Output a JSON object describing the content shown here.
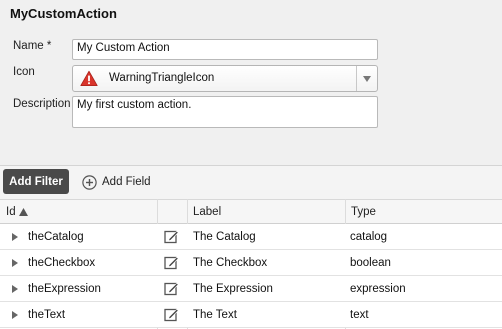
{
  "panel": {
    "title": "MyCustomAction"
  },
  "form": {
    "name_label": "Name *",
    "name_value": "My Custom Action",
    "icon_label": "Icon",
    "icon_value": "WarningTriangleIcon",
    "description_label": "Description",
    "description_value": "My first custom action."
  },
  "toolbar": {
    "add_filter_label": "Add Filter",
    "add_field_label": "Add Field"
  },
  "table": {
    "columns": [
      "Id",
      "Label",
      "Type"
    ],
    "sort_column": "Id",
    "sort_direction": "ascending",
    "rows": [
      {
        "id": "theCatalog",
        "label": "The Catalog",
        "type": "catalog"
      },
      {
        "id": "theCheckbox",
        "label": "The Checkbox",
        "type": "boolean"
      },
      {
        "id": "theExpression",
        "label": "The Expression",
        "type": "expression"
      },
      {
        "id": "theText",
        "label": "The Text",
        "type": "text"
      }
    ]
  },
  "colors": {
    "warning_icon": "#d9342b",
    "add_filter_bg": "#4a4a4a"
  },
  "icons": {
    "icon_select": "warning-triangle-icon",
    "add_field": "plus-circle-icon",
    "row_edit": "edit-icon",
    "row_expand": "expand-arrow-icon",
    "sort": "sort-ascending-icon",
    "dropdown": "chevron-down-icon"
  }
}
